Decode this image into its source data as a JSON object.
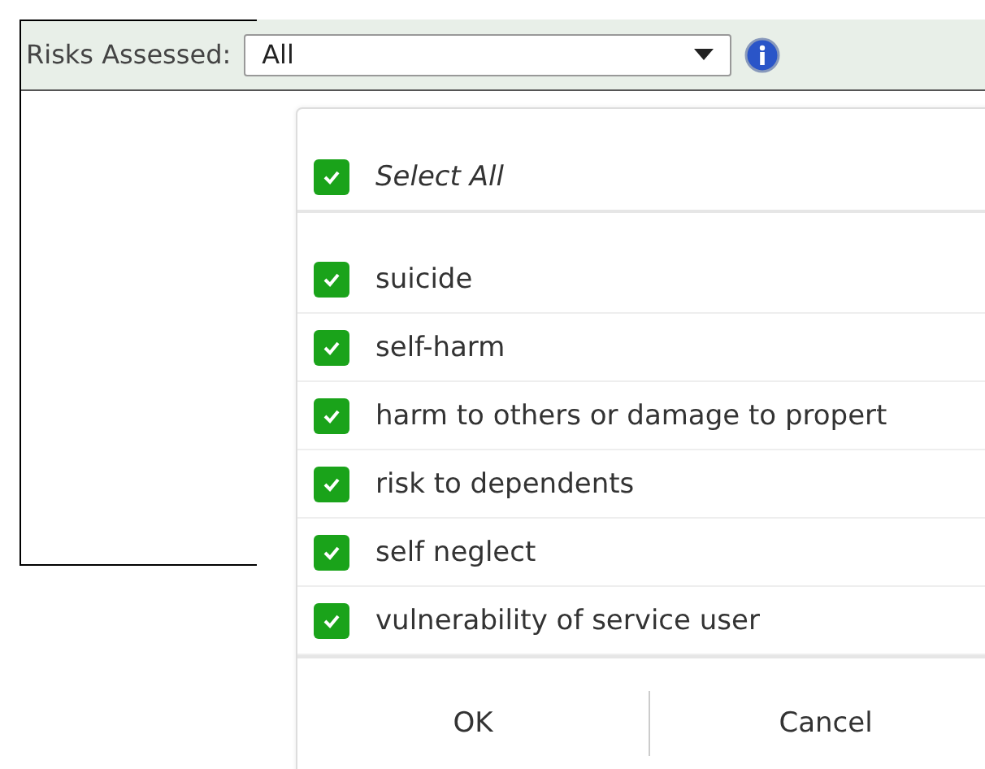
{
  "filter": {
    "label": "Risks Assessed:",
    "value": "All"
  },
  "select_all": {
    "label": "Select All",
    "checked": true
  },
  "options": [
    {
      "label": "suicide",
      "checked": true
    },
    {
      "label": "self-harm",
      "checked": true
    },
    {
      "label": "harm to others or damage to propert",
      "checked": true
    },
    {
      "label": "risk to dependents",
      "checked": true
    },
    {
      "label": "self neglect",
      "checked": true
    },
    {
      "label": "vulnerability of service user",
      "checked": true
    }
  ],
  "buttons": [
    "OK",
    "Cancel"
  ]
}
